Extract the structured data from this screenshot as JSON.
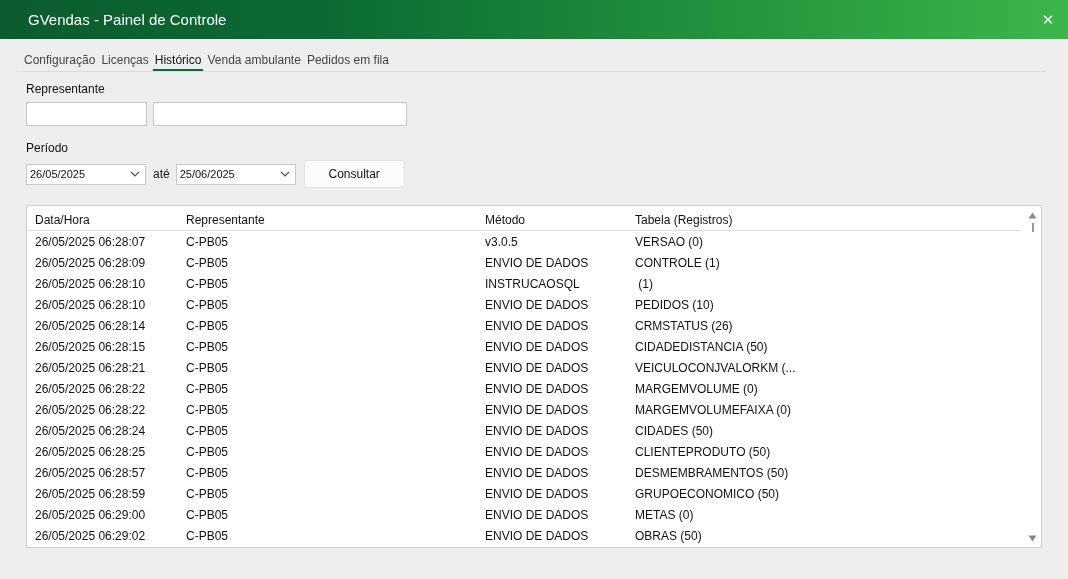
{
  "window": {
    "title": "GVendas - Painel de Controle",
    "close": "✕"
  },
  "tabs": [
    {
      "label": "Configuração",
      "selected": false
    },
    {
      "label": "Licenças",
      "selected": false
    },
    {
      "label": "Histórico",
      "selected": true
    },
    {
      "label": "Venda ambulante",
      "selected": false
    },
    {
      "label": "Pedidos em fila",
      "selected": false
    }
  ],
  "filters": {
    "representante_label": "Representante",
    "periodo_label": "Período",
    "date_from": "26/05/2025",
    "separator": "até",
    "date_to": "25/06/2025",
    "button": "Consultar"
  },
  "table": {
    "columns": [
      "Data/Hora",
      "Representante",
      "Método",
      "Tabela (Registros)"
    ],
    "rows": [
      [
        "26/05/2025 06:28:07",
        "C-PB05",
        "v3.0.5",
        "VERSAO (0)"
      ],
      [
        "26/05/2025 06:28:09",
        "C-PB05",
        "ENVIO DE DADOS",
        "CONTROLE (1)"
      ],
      [
        "26/05/2025 06:28:10",
        "C-PB05",
        "INSTRUCAOSQL",
        " (1)"
      ],
      [
        "26/05/2025 06:28:10",
        "C-PB05",
        "ENVIO DE DADOS",
        "PEDIDOS (10)"
      ],
      [
        "26/05/2025 06:28:14",
        "C-PB05",
        "ENVIO DE DADOS",
        "CRMSTATUS (26)"
      ],
      [
        "26/05/2025 06:28:15",
        "C-PB05",
        "ENVIO DE DADOS",
        "CIDADEDISTANCIA (50)"
      ],
      [
        "26/05/2025 06:28:21",
        "C-PB05",
        "ENVIO DE DADOS",
        "VEICULOCONJVALORKM (..."
      ],
      [
        "26/05/2025 06:28:22",
        "C-PB05",
        "ENVIO DE DADOS",
        "MARGEMVOLUME (0)"
      ],
      [
        "26/05/2025 06:28:22",
        "C-PB05",
        "ENVIO DE DADOS",
        "MARGEMVOLUMEFAIXA (0)"
      ],
      [
        "26/05/2025 06:28:24",
        "C-PB05",
        "ENVIO DE DADOS",
        "CIDADES (50)"
      ],
      [
        "26/05/2025 06:28:25",
        "C-PB05",
        "ENVIO DE DADOS",
        "CLIENTEPRODUTO (50)"
      ],
      [
        "26/05/2025 06:28:57",
        "C-PB05",
        "ENVIO DE DADOS",
        "DESMEMBRAMENTOS (50)"
      ],
      [
        "26/05/2025 06:28:59",
        "C-PB05",
        "ENVIO DE DADOS",
        "GRUPOECONOMICO (50)"
      ],
      [
        "26/05/2025 06:29:00",
        "C-PB05",
        "ENVIO DE DADOS",
        "METAS (0)"
      ],
      [
        "26/05/2025 06:29:02",
        "C-PB05",
        "ENVIO DE DADOS",
        "OBRAS (50)"
      ]
    ]
  }
}
